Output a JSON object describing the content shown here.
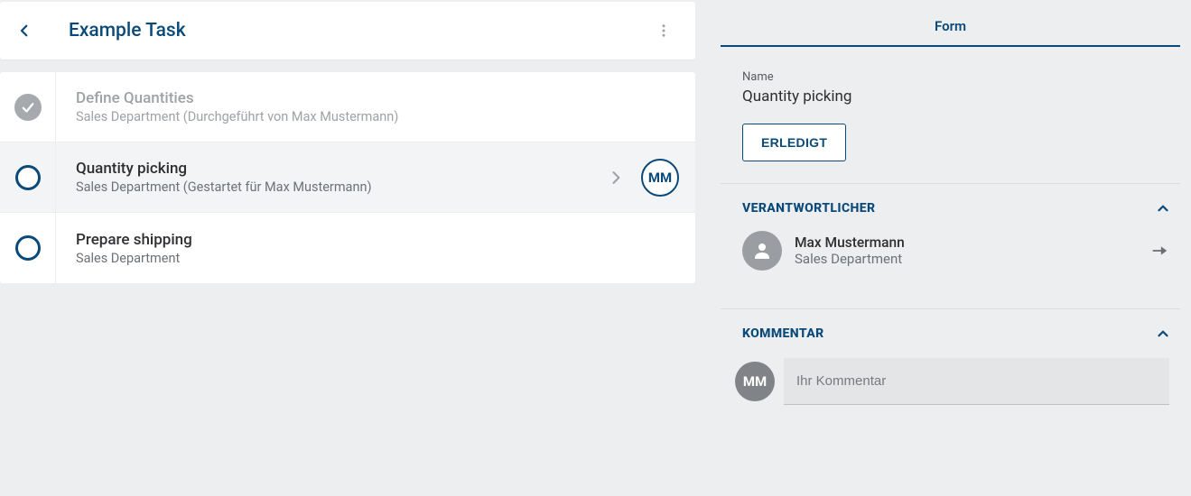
{
  "header": {
    "title": "Example Task"
  },
  "tasks": [
    {
      "name": "Define Quantities",
      "subtitle": "Sales Department (Durchgeführt von Max Mustermann)"
    },
    {
      "name": "Quantity picking",
      "subtitle": "Sales Department (Gestartet für Max Mustermann)",
      "avatar_initials": "MM"
    },
    {
      "name": "Prepare shipping",
      "subtitle": "Sales Department"
    }
  ],
  "form": {
    "tab_label": "Form",
    "name_label": "Name",
    "name_value": "Quantity picking",
    "done_label": "ERLEDIGT",
    "responsible_heading": "VERANTWORTLICHER",
    "responsible": {
      "name": "Max Mustermann",
      "department": "Sales Department"
    },
    "comment_heading": "KOMMENTAR",
    "comment_placeholder": "Ihr Kommentar",
    "comment_avatar_initials": "MM"
  }
}
